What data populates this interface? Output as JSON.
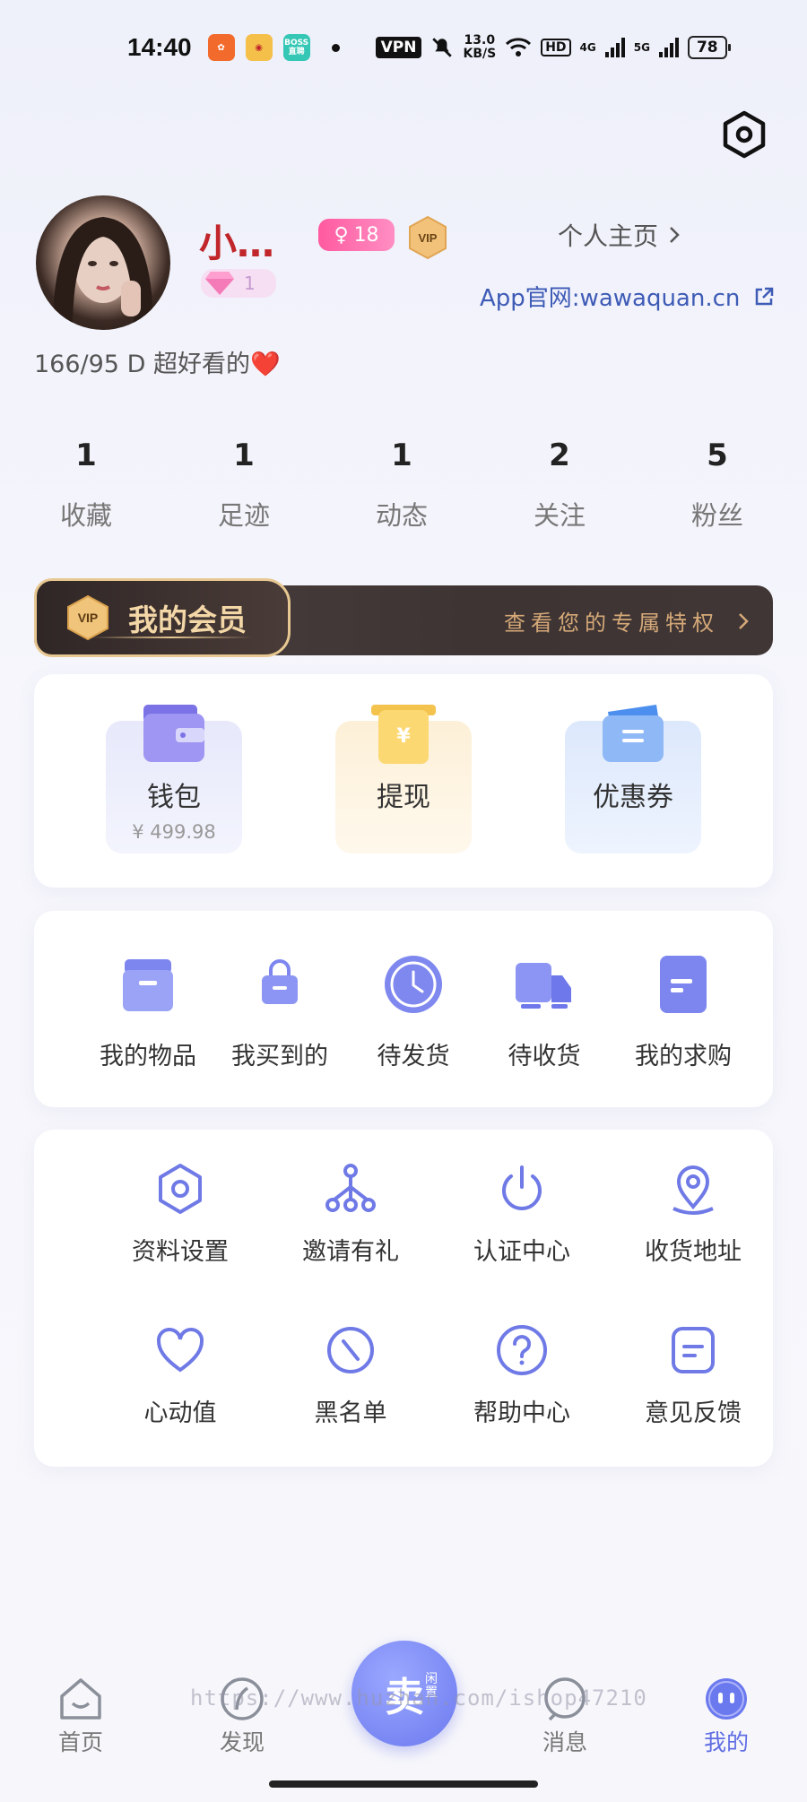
{
  "status_bar": {
    "time": "14:40",
    "vpn": "VPN",
    "speed_value": "13.0",
    "speed_unit": "KB/S",
    "hd": "HD",
    "net1": "4G",
    "net2": "5G",
    "battery": "78",
    "app_boss": "BOSS直聘"
  },
  "profile": {
    "nickname": "小…",
    "age": "18",
    "vip_badge": "VIP",
    "gem_count": "1",
    "homepage_label": "个人主页",
    "site_label": "App官网:wawaquan.cn",
    "bio": "166/95 D 超好看的❤️"
  },
  "stats": [
    {
      "value": "1",
      "label": "收藏"
    },
    {
      "value": "1",
      "label": "足迹"
    },
    {
      "value": "1",
      "label": "动态"
    },
    {
      "value": "2",
      "label": "关注"
    },
    {
      "value": "5",
      "label": "粉丝"
    }
  ],
  "vip_bar": {
    "tag_icon_text": "VIP",
    "title": "我的会员",
    "privilege": "查看您的专属特权"
  },
  "wallet": {
    "wallet_label": "钱包",
    "wallet_amount": "¥ 499.98",
    "withdraw_label": "提现",
    "withdraw_icon_text": "¥",
    "coupon_label": "优惠券"
  },
  "orders": [
    {
      "label": "我的物品",
      "icon": "box-icon"
    },
    {
      "label": "我买到的",
      "icon": "shopping-bag-icon"
    },
    {
      "label": "待发货",
      "icon": "clock-icon"
    },
    {
      "label": "待收货",
      "icon": "truck-icon"
    },
    {
      "label": "我的求购",
      "icon": "clipboard-icon"
    }
  ],
  "tools": [
    {
      "label": "资料设置",
      "icon": "hexagon-settings-icon"
    },
    {
      "label": "邀请有礼",
      "icon": "share-tree-icon"
    },
    {
      "label": "认证中心",
      "icon": "power-icon"
    },
    {
      "label": "收货地址",
      "icon": "location-pin-icon"
    },
    {
      "label": "心动值",
      "icon": "heart-icon"
    },
    {
      "label": "黑名单",
      "icon": "block-icon"
    },
    {
      "label": "帮助中心",
      "icon": "question-icon"
    },
    {
      "label": "意见反馈",
      "icon": "feedback-icon"
    }
  ],
  "nav": {
    "home": "首页",
    "discover": "发现",
    "sell_main": "卖",
    "sell_sub": "闲置",
    "messages": "消息",
    "mine": "我的"
  },
  "watermark": "https://www.huzhan.com/ishop47210",
  "colors": {
    "accent": "#6b79ef",
    "nickname": "#c0262a",
    "link": "#3e5bb6",
    "vip_gold": "#e8c892"
  }
}
